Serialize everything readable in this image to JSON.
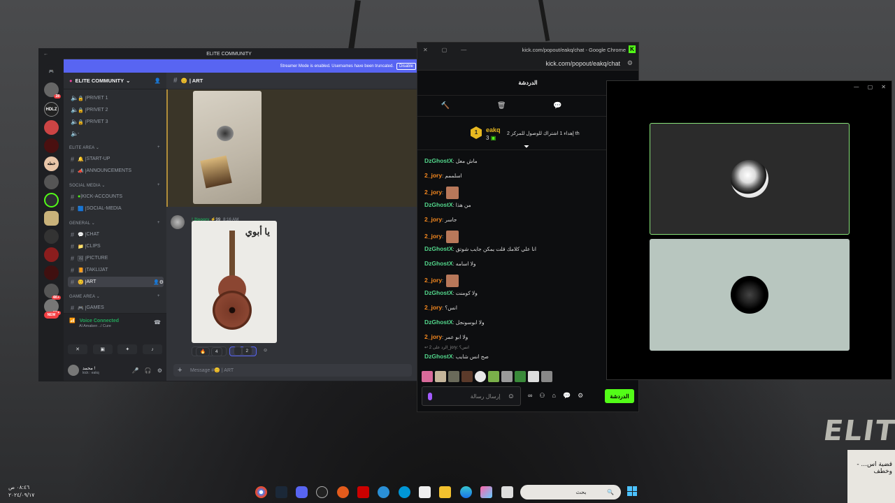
{
  "discord": {
    "window_title": "ELITE COMMUNITY",
    "banner_text": "Streamer Mode is enabled. Usernames have been truncated.",
    "banner_button": "Disable",
    "server_name": "ELITE COMMUNITY",
    "guild_labels": [
      "HDLZ",
      "خطه",
      "NEW"
    ],
    "guild_badges": [
      "28",
      "4K+",
      "1K+"
    ],
    "channels_top": [
      "PRIVET 1",
      "PRIVET 2",
      "PRIVET 3",
      "-"
    ],
    "categories": {
      "elite": "ELITE AREA",
      "social": "SOCIAL MEDIA",
      "general": "GENERAL",
      "game": "GAME AREA"
    },
    "channels_elite": [
      "START-UP",
      "ANNOUNCEMENTS"
    ],
    "channels_social": [
      "KICK-ACCOUNTS",
      "SOCIAL-MEDIA"
    ],
    "channels_general": [
      "CHAT",
      "CLIPS",
      "PICTURE",
      "TAKLIJAT",
      "ART"
    ],
    "channels_game": [
      "GAMES"
    ],
    "voice_status": "Voice Connected",
    "voice_channel": "Al Amaken ../ Cure",
    "user_name": "محمد !",
    "user_status": "kick : eakq",
    "chat_header": "| ART",
    "msg_user": "! 2jooory",
    "msg_badge": "99",
    "msg_time": "8:16 AM",
    "art_title": "يا أبوي",
    "reactions": [
      {
        "emoji": "🔥",
        "count": "4"
      },
      {
        "emoji": "",
        "count": "2"
      }
    ],
    "message_placeholder": "Message #😊 | ART"
  },
  "kick": {
    "window_title": "kick.com/popout/eakq/chat - Google Chrome",
    "url": "kick.com/popout/eakq/chat",
    "header": "الدردشة",
    "pinned_user": "eakq",
    "pinned_count": "3",
    "pinned_text": "إهداء 1 اشتراك للوصول للمركز 2 th",
    "messages": [
      {
        "user": "DzGhostX",
        "color": "#53d88c",
        "text": "ماش معل",
        "emote": false
      },
      {
        "user": "2_jory",
        "color": "#f6891f",
        "text": "اسلممم",
        "emote": false
      },
      {
        "user": "2_jory",
        "color": "#f6891f",
        "text": "",
        "emote": true
      },
      {
        "user": "DzGhostX",
        "color": "#53d88c",
        "text": "من هذا",
        "emote": false
      },
      {
        "user": "2_jory",
        "color": "#f6891f",
        "text": "جاسر",
        "emote": false
      },
      {
        "user": "2_jory",
        "color": "#f6891f",
        "text": "",
        "emote": true
      },
      {
        "user": "DzGhostX",
        "color": "#53d88c",
        "text": "انا علي كلامك قلت يمكن جايب شوتق",
        "emote": false
      },
      {
        "user": "DzGhostX",
        "color": "#53d88c",
        "text": "ولا اسامه",
        "emote": false
      },
      {
        "user": "2_jory",
        "color": "#f6891f",
        "text": "",
        "emote": true
      },
      {
        "user": "DzGhostX",
        "color": "#53d88c",
        "text": "ولا كومنت",
        "emote": false
      },
      {
        "user": "2_jory",
        "color": "#f6891f",
        "text": "انس؟",
        "emote": false
      },
      {
        "user": "DzGhostX",
        "color": "#53d88c",
        "text": "ولا ابوسونجل",
        "emote": false
      },
      {
        "user": "2_jory",
        "color": "#f6891f",
        "text": "ولا ابو عمر",
        "emote": false
      },
      {
        "user": "DzGhostX",
        "color": "#53d88c",
        "text": "صح انس شايب",
        "emote": false
      }
    ],
    "reply_text": "الرد على 2_jory: انس؟",
    "input_placeholder": "إرسال رسالة",
    "send_button": "الدردشة"
  },
  "desktop": {
    "brand_logo": "ELITE",
    "notification_text": "قضية اس... - وخطف",
    "search_placeholder": "بحث",
    "clock_time": "٠٨:٤٦ ص",
    "clock_date": "٢٠٢٤/٠٩/١٧"
  }
}
